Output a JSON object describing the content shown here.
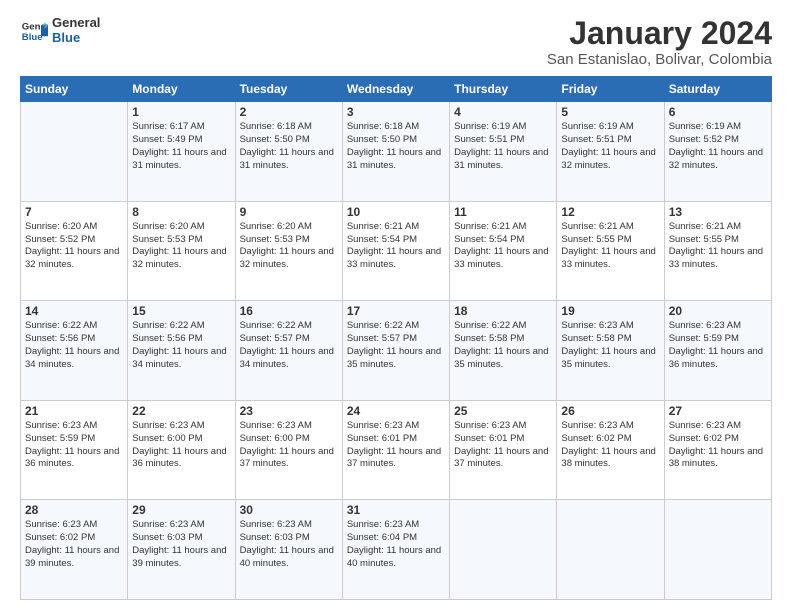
{
  "logo": {
    "general": "General",
    "blue": "Blue"
  },
  "header": {
    "title": "January 2024",
    "subtitle": "San Estanislao, Bolivar, Colombia"
  },
  "weekdays": [
    "Sunday",
    "Monday",
    "Tuesday",
    "Wednesday",
    "Thursday",
    "Friday",
    "Saturday"
  ],
  "weeks": [
    [
      {
        "day": "",
        "sunrise": "",
        "sunset": "",
        "daylight": ""
      },
      {
        "day": "1",
        "sunrise": "Sunrise: 6:17 AM",
        "sunset": "Sunset: 5:49 PM",
        "daylight": "Daylight: 11 hours and 31 minutes."
      },
      {
        "day": "2",
        "sunrise": "Sunrise: 6:18 AM",
        "sunset": "Sunset: 5:50 PM",
        "daylight": "Daylight: 11 hours and 31 minutes."
      },
      {
        "day": "3",
        "sunrise": "Sunrise: 6:18 AM",
        "sunset": "Sunset: 5:50 PM",
        "daylight": "Daylight: 11 hours and 31 minutes."
      },
      {
        "day": "4",
        "sunrise": "Sunrise: 6:19 AM",
        "sunset": "Sunset: 5:51 PM",
        "daylight": "Daylight: 11 hours and 31 minutes."
      },
      {
        "day": "5",
        "sunrise": "Sunrise: 6:19 AM",
        "sunset": "Sunset: 5:51 PM",
        "daylight": "Daylight: 11 hours and 32 minutes."
      },
      {
        "day": "6",
        "sunrise": "Sunrise: 6:19 AM",
        "sunset": "Sunset: 5:52 PM",
        "daylight": "Daylight: 11 hours and 32 minutes."
      }
    ],
    [
      {
        "day": "7",
        "sunrise": "Sunrise: 6:20 AM",
        "sunset": "Sunset: 5:52 PM",
        "daylight": "Daylight: 11 hours and 32 minutes."
      },
      {
        "day": "8",
        "sunrise": "Sunrise: 6:20 AM",
        "sunset": "Sunset: 5:53 PM",
        "daylight": "Daylight: 11 hours and 32 minutes."
      },
      {
        "day": "9",
        "sunrise": "Sunrise: 6:20 AM",
        "sunset": "Sunset: 5:53 PM",
        "daylight": "Daylight: 11 hours and 32 minutes."
      },
      {
        "day": "10",
        "sunrise": "Sunrise: 6:21 AM",
        "sunset": "Sunset: 5:54 PM",
        "daylight": "Daylight: 11 hours and 33 minutes."
      },
      {
        "day": "11",
        "sunrise": "Sunrise: 6:21 AM",
        "sunset": "Sunset: 5:54 PM",
        "daylight": "Daylight: 11 hours and 33 minutes."
      },
      {
        "day": "12",
        "sunrise": "Sunrise: 6:21 AM",
        "sunset": "Sunset: 5:55 PM",
        "daylight": "Daylight: 11 hours and 33 minutes."
      },
      {
        "day": "13",
        "sunrise": "Sunrise: 6:21 AM",
        "sunset": "Sunset: 5:55 PM",
        "daylight": "Daylight: 11 hours and 33 minutes."
      }
    ],
    [
      {
        "day": "14",
        "sunrise": "Sunrise: 6:22 AM",
        "sunset": "Sunset: 5:56 PM",
        "daylight": "Daylight: 11 hours and 34 minutes."
      },
      {
        "day": "15",
        "sunrise": "Sunrise: 6:22 AM",
        "sunset": "Sunset: 5:56 PM",
        "daylight": "Daylight: 11 hours and 34 minutes."
      },
      {
        "day": "16",
        "sunrise": "Sunrise: 6:22 AM",
        "sunset": "Sunset: 5:57 PM",
        "daylight": "Daylight: 11 hours and 34 minutes."
      },
      {
        "day": "17",
        "sunrise": "Sunrise: 6:22 AM",
        "sunset": "Sunset: 5:57 PM",
        "daylight": "Daylight: 11 hours and 35 minutes."
      },
      {
        "day": "18",
        "sunrise": "Sunrise: 6:22 AM",
        "sunset": "Sunset: 5:58 PM",
        "daylight": "Daylight: 11 hours and 35 minutes."
      },
      {
        "day": "19",
        "sunrise": "Sunrise: 6:23 AM",
        "sunset": "Sunset: 5:58 PM",
        "daylight": "Daylight: 11 hours and 35 minutes."
      },
      {
        "day": "20",
        "sunrise": "Sunrise: 6:23 AM",
        "sunset": "Sunset: 5:59 PM",
        "daylight": "Daylight: 11 hours and 36 minutes."
      }
    ],
    [
      {
        "day": "21",
        "sunrise": "Sunrise: 6:23 AM",
        "sunset": "Sunset: 5:59 PM",
        "daylight": "Daylight: 11 hours and 36 minutes."
      },
      {
        "day": "22",
        "sunrise": "Sunrise: 6:23 AM",
        "sunset": "Sunset: 6:00 PM",
        "daylight": "Daylight: 11 hours and 36 minutes."
      },
      {
        "day": "23",
        "sunrise": "Sunrise: 6:23 AM",
        "sunset": "Sunset: 6:00 PM",
        "daylight": "Daylight: 11 hours and 37 minutes."
      },
      {
        "day": "24",
        "sunrise": "Sunrise: 6:23 AM",
        "sunset": "Sunset: 6:01 PM",
        "daylight": "Daylight: 11 hours and 37 minutes."
      },
      {
        "day": "25",
        "sunrise": "Sunrise: 6:23 AM",
        "sunset": "Sunset: 6:01 PM",
        "daylight": "Daylight: 11 hours and 37 minutes."
      },
      {
        "day": "26",
        "sunrise": "Sunrise: 6:23 AM",
        "sunset": "Sunset: 6:02 PM",
        "daylight": "Daylight: 11 hours and 38 minutes."
      },
      {
        "day": "27",
        "sunrise": "Sunrise: 6:23 AM",
        "sunset": "Sunset: 6:02 PM",
        "daylight": "Daylight: 11 hours and 38 minutes."
      }
    ],
    [
      {
        "day": "28",
        "sunrise": "Sunrise: 6:23 AM",
        "sunset": "Sunset: 6:02 PM",
        "daylight": "Daylight: 11 hours and 39 minutes."
      },
      {
        "day": "29",
        "sunrise": "Sunrise: 6:23 AM",
        "sunset": "Sunset: 6:03 PM",
        "daylight": "Daylight: 11 hours and 39 minutes."
      },
      {
        "day": "30",
        "sunrise": "Sunrise: 6:23 AM",
        "sunset": "Sunset: 6:03 PM",
        "daylight": "Daylight: 11 hours and 40 minutes."
      },
      {
        "day": "31",
        "sunrise": "Sunrise: 6:23 AM",
        "sunset": "Sunset: 6:04 PM",
        "daylight": "Daylight: 11 hours and 40 minutes."
      },
      {
        "day": "",
        "sunrise": "",
        "sunset": "",
        "daylight": ""
      },
      {
        "day": "",
        "sunrise": "",
        "sunset": "",
        "daylight": ""
      },
      {
        "day": "",
        "sunrise": "",
        "sunset": "",
        "daylight": ""
      }
    ]
  ]
}
